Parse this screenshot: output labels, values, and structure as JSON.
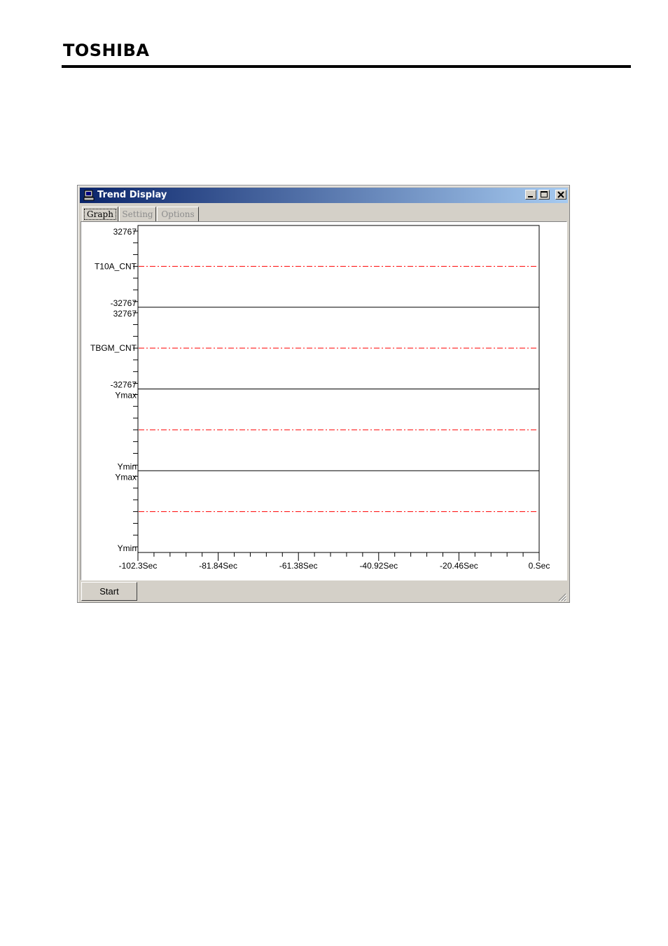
{
  "brand": {
    "logo_text": "TOSHIBA"
  },
  "window": {
    "title": "Trend Display",
    "icons": {
      "app": "computer-icon",
      "minimize": "minimize-icon",
      "maximize": "maximize-icon",
      "close": "close-icon"
    }
  },
  "tabs": [
    {
      "label": "Graph",
      "selected": true
    },
    {
      "label": "Setting",
      "enabled": false
    },
    {
      "label": "Options",
      "enabled": false
    }
  ],
  "buttons": {
    "start": "Start"
  },
  "colors": {
    "trend_line": "#ff0000",
    "titlebar_start": "#0a246a",
    "titlebar_end": "#a6caf0"
  },
  "chart_data": {
    "type": "line",
    "x_ticks": [
      "-102.3Sec",
      "-81.84Sec",
      "-61.38Sec",
      "-40.92Sec",
      "-20.46Sec",
      "0.Sec"
    ],
    "x_range": [
      -102.3,
      0
    ],
    "panels": [
      {
        "top_label": "32767",
        "bottom_label": "-32767",
        "series_name": "T10A_CNT",
        "level": 0.5
      },
      {
        "top_label": "32767",
        "bottom_label": "-32767",
        "series_name": "TBGM_CNT",
        "level": 0.5
      },
      {
        "top_label": "Ymax",
        "bottom_label": "Ymin",
        "series_name": "",
        "level": 0.5
      },
      {
        "top_label": "Ymax",
        "bottom_label": "Ymin",
        "series_name": "",
        "level": 0.5
      }
    ],
    "line_style": "dash-dot",
    "grid": false
  }
}
